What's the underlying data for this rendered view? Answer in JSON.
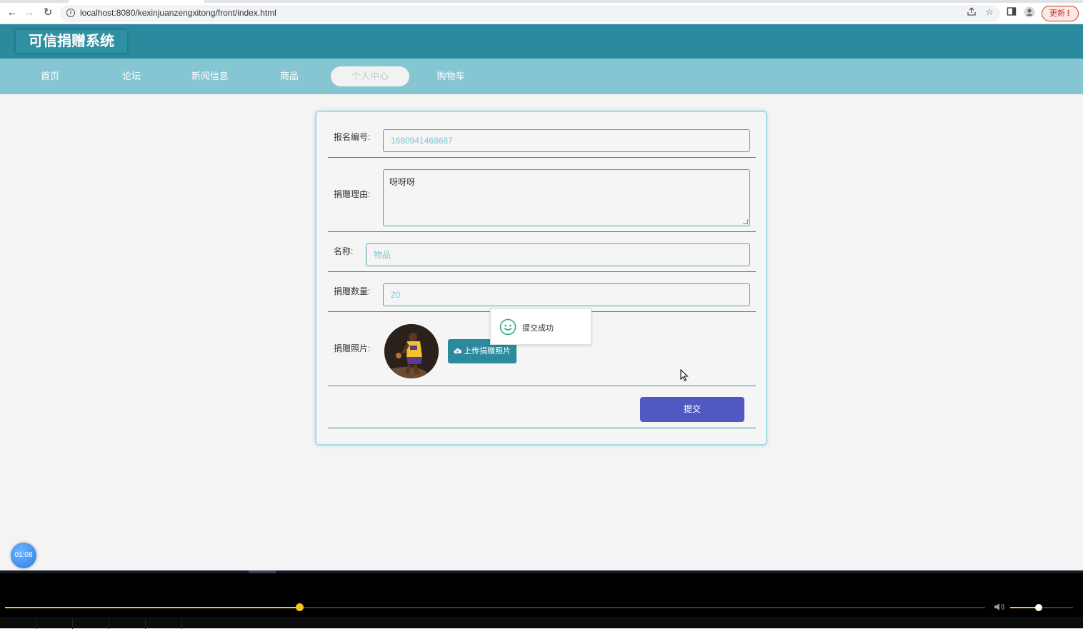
{
  "browser": {
    "url": "localhost:8080/kexinjuanzengxitong/front/index.html",
    "back_icon": "←",
    "forward_icon": "→",
    "reload_icon": "↻",
    "update_label": "更新",
    "menu_dots": "⋮"
  },
  "site": {
    "title": "可信捐赠系统",
    "nav": [
      {
        "label": "首页"
      },
      {
        "label": "论坛"
      },
      {
        "label": "新闻信息"
      },
      {
        "label": "商品"
      },
      {
        "label": "个人中心"
      },
      {
        "label": "购物车"
      }
    ]
  },
  "form": {
    "reg_no_label": "报名编号:",
    "reg_no_value": "1680941468687",
    "reason_label": "捐赠理由:",
    "reason_value": "呀呀呀",
    "name_label": "名称:",
    "name_value": "物品",
    "qty_label": "捐赠数量:",
    "qty_value": "20",
    "photo_label": "捐赠照片:",
    "upload_label": "上传捐赠照片",
    "submit_label": "提交"
  },
  "toast": {
    "message": "提交成功"
  },
  "timer": {
    "value": "01:08"
  },
  "player": {
    "progress": 0.3,
    "volume": 0.45
  },
  "colors": {
    "header": "#2c8a9e",
    "nav": "#86c5d2",
    "submit": "#5058c2",
    "toast_icon": "#3aa87a",
    "progress": "#f5c518"
  }
}
